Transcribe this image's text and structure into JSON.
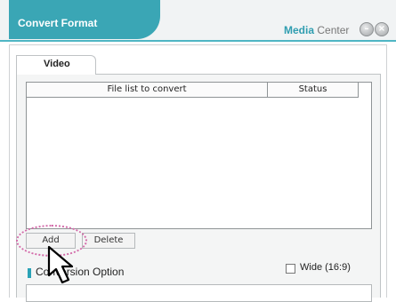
{
  "window": {
    "title": "Convert Format",
    "brand_strong": "Media",
    "brand_rest": " Center"
  },
  "tabs": [
    {
      "label": "Video",
      "selected": true
    }
  ],
  "file_list": {
    "columns": [
      "File list to convert",
      "Status"
    ],
    "rows": []
  },
  "buttons": {
    "add": "Add",
    "delete": "Delete"
  },
  "conversion_option": {
    "label": "Conversion Option",
    "wide_checkbox_label": "Wide (16:9)",
    "wide_checked": false
  },
  "colors": {
    "accent": "#3aa6b5",
    "highlight_circle": "#d36aa9"
  },
  "icons": {
    "minimize": "minimize-icon",
    "close": "close-icon",
    "cursor": "arrow-cursor-icon"
  }
}
